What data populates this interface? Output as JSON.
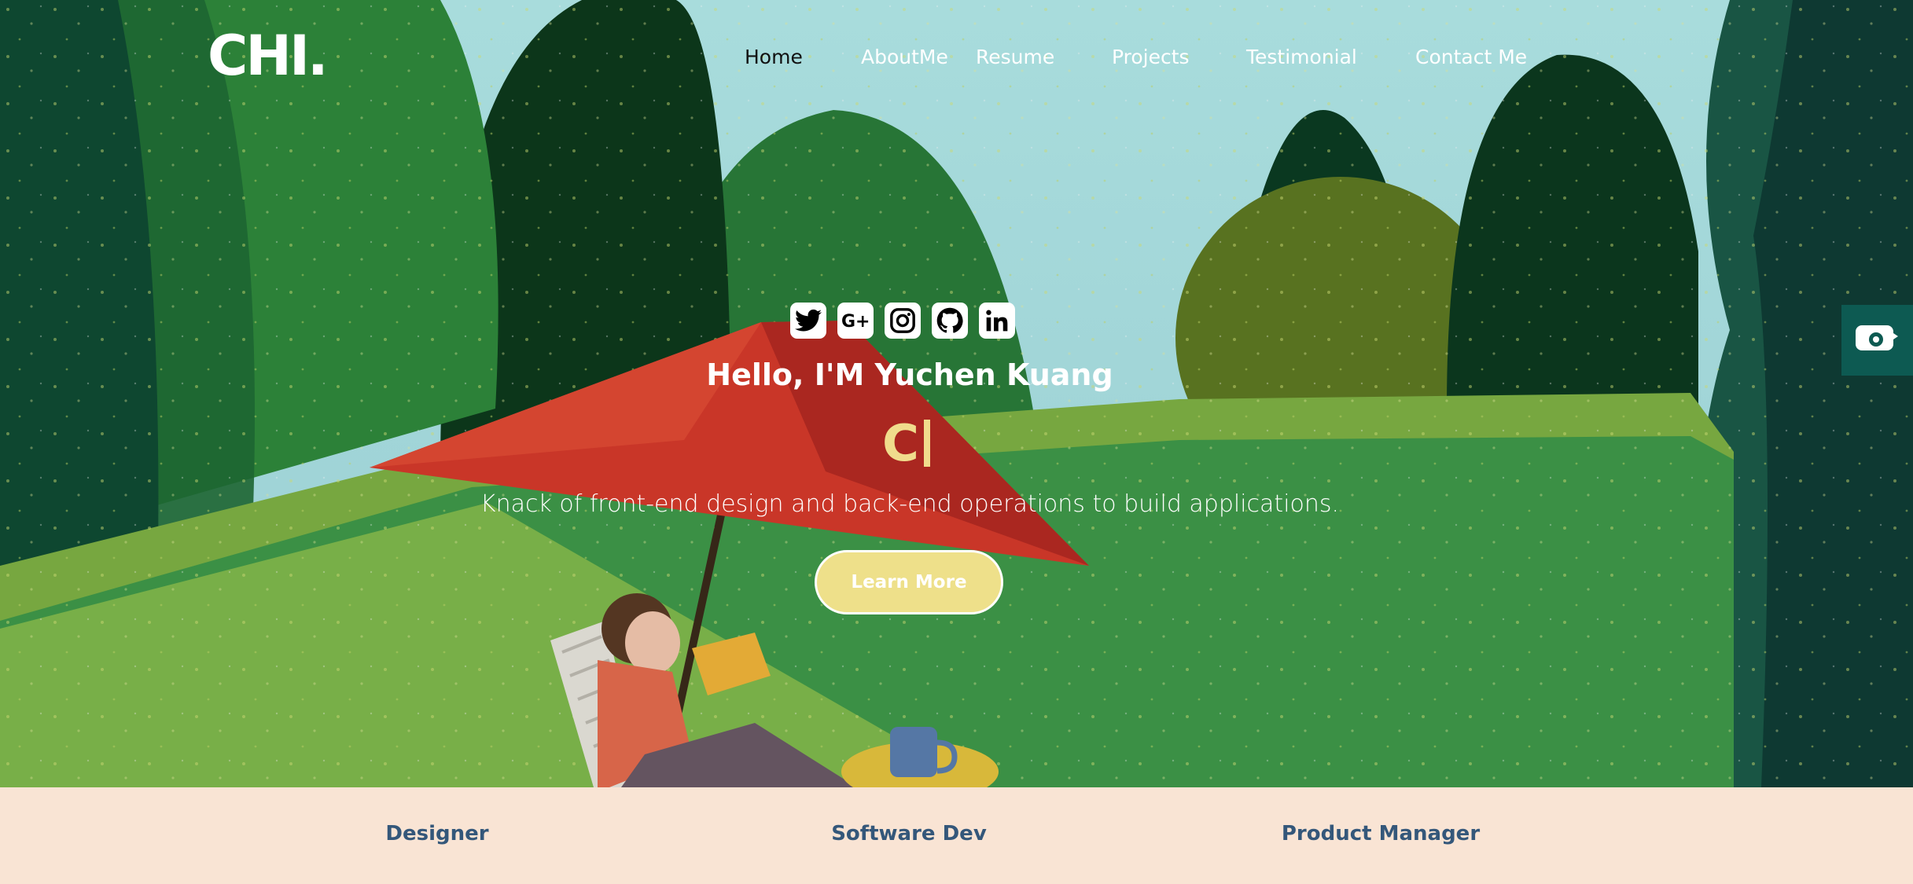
{
  "header": {
    "logo": "CHI.",
    "nav": [
      {
        "label": "Home",
        "active": true
      },
      {
        "label": "AboutMe",
        "active": false
      },
      {
        "label": "Resume",
        "active": false
      },
      {
        "label": "Projects",
        "active": false
      },
      {
        "label": "Testimonial",
        "active": false
      },
      {
        "label": "Contact Me",
        "active": false
      }
    ]
  },
  "hero": {
    "socials": [
      "twitter-icon",
      "google-plus-icon",
      "instagram-icon",
      "github-icon",
      "linkedin-icon"
    ],
    "greeting": "Hello, I'M Yuchen Kuang",
    "typed_text": "C",
    "tagline": "Knack of front-end design and back-end operations to build applications.",
    "cta_label": "Learn More"
  },
  "roles": [
    "Designer",
    "Software Dev",
    "Product Manager"
  ],
  "widgets": {
    "side_icon": "chat-icon",
    "to_top_icon": "arrow-up-icon"
  },
  "colors": {
    "accent": "#f0dc8c",
    "button": "#eee08a",
    "roles_text": "#34577a",
    "roles_bg": "#f9e4d4",
    "side_widget": "#0d5a52",
    "to_top_bg": "#34577a"
  }
}
